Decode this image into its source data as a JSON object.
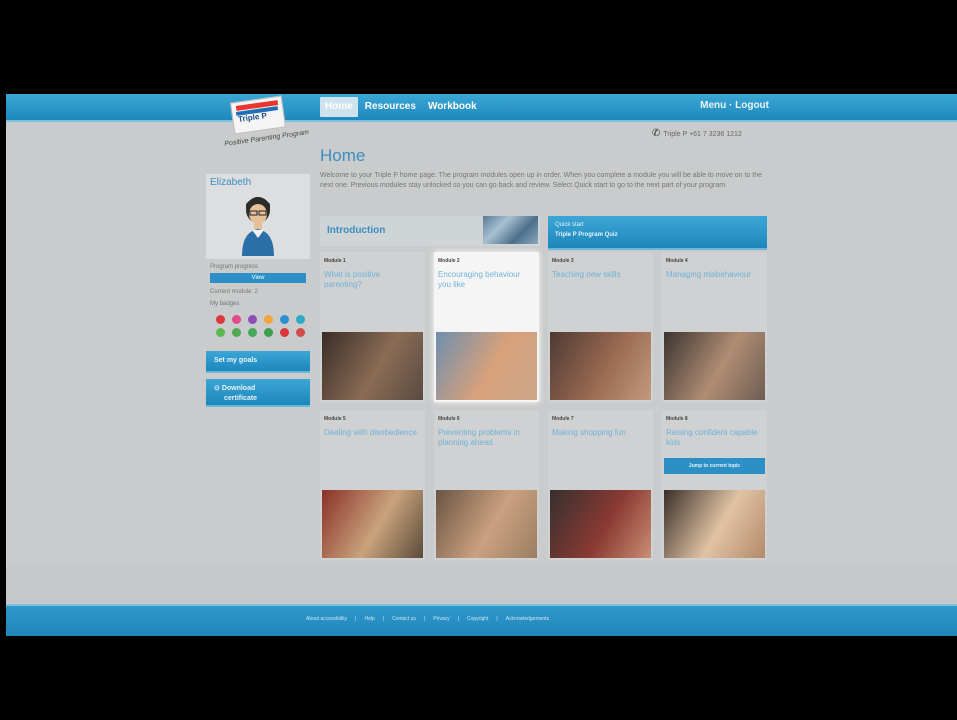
{
  "nav": {
    "tabs": [
      "Home",
      "Resources",
      "Workbook"
    ],
    "right": "Menu · Logout"
  },
  "brand": {
    "name": "Triple P",
    "tagline": "Positive Parenting Program"
  },
  "header": {
    "phone_text": "Triple P +61 7 3236 1212"
  },
  "page": {
    "title": "Home",
    "intro": "Welcome to your Triple P home page. The program modules open up in order. When you complete a module you will be able to move on to the next one. Previous modules stay unlocked so you can go back and review. Select Quick start to go to the next part of your program."
  },
  "sidebar": {
    "user_name": "Elizabeth",
    "progress_label": "Program progress",
    "progress_btn": "View",
    "line": "Current module: 2",
    "awards_label": "My badges",
    "badge_colors": [
      "#d9363e",
      "#e04c8a",
      "#8a4fb6",
      "#f2a33a",
      "#2b8fd0",
      "#2fa8c8",
      "#5bb84e",
      "#4fa852",
      "#46a85a",
      "#3d9e4f",
      "#d9363e",
      "#d04d4d"
    ],
    "btn_goals": "Set my goals",
    "btn_certificate_l1": "Download",
    "btn_certificate_l2": "certificate"
  },
  "intro_banner": {
    "label": "Introduction"
  },
  "quickstart": {
    "line1": "Quick start",
    "line2": "Triple P Program Quiz"
  },
  "modules": [
    {
      "num": "Module 1",
      "title": "What is positive parenting?",
      "photo": [
        "#3a2d27",
        "#8a6c55",
        "#5a4a40"
      ]
    },
    {
      "num": "Module 2",
      "title": "Encouraging behaviour you like",
      "photo": [
        "#6f8fae",
        "#d8a17b",
        "#caa587"
      ],
      "highlight": true
    },
    {
      "num": "Module 3",
      "title": "Teaching new skills",
      "photo": [
        "#4e3a33",
        "#9a6a52",
        "#c39a7d"
      ]
    },
    {
      "num": "Module 4",
      "title": "Managing misbehaviour",
      "photo": [
        "#3c3430",
        "#b08d74",
        "#6e5d52"
      ]
    },
    {
      "num": "Module 5",
      "title": "Dealing with disobedience",
      "photo": [
        "#8a3128",
        "#c9a37c",
        "#5a4a3a"
      ]
    },
    {
      "num": "Module 6",
      "title": "Preventing problems in planning ahead",
      "photo": [
        "#6a5442",
        "#caa180",
        "#9a7e62"
      ]
    },
    {
      "num": "Module 7",
      "title": "Making shopping fun",
      "photo": [
        "#362f2d",
        "#8b3a33",
        "#c98e74"
      ]
    },
    {
      "num": "Module 8",
      "title": "Raising confident capable kids",
      "photo": [
        "#3a2f28",
        "#e1c3a4",
        "#b28a6a"
      ],
      "button": "Jump to current topic"
    }
  ],
  "footer": {
    "links": [
      "About accessibility",
      "Help",
      "Contact us",
      "Privacy",
      "Copyright",
      "Acknowledgements"
    ]
  }
}
